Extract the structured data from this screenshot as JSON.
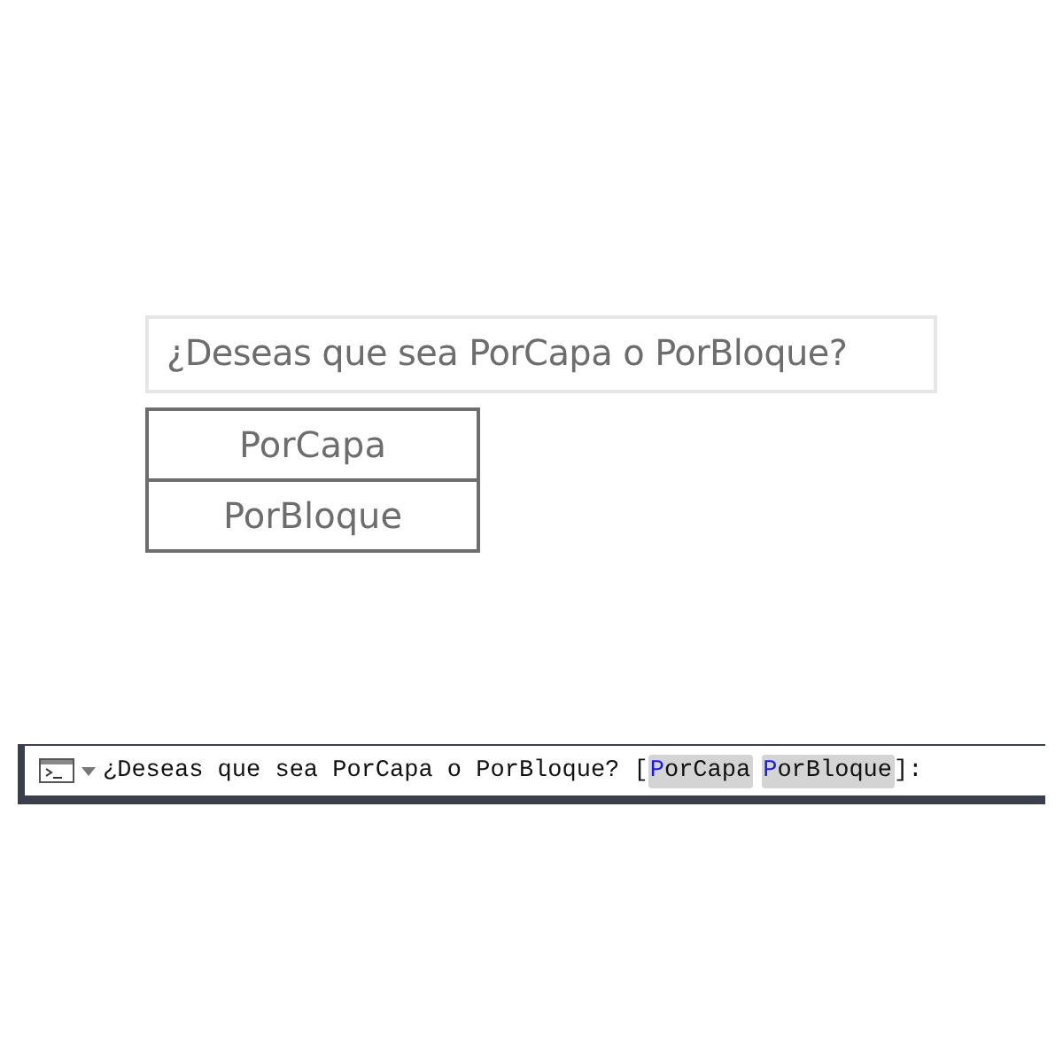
{
  "dynamic_prompt": {
    "text": "¿Deseas que sea PorCapa o PorBloque?"
  },
  "options_menu": [
    {
      "label": "PorCapa"
    },
    {
      "label": "PorBloque"
    }
  ],
  "command_line": {
    "prompt": "¿Deseas que sea PorCapa o PorBloque?",
    "open": "[",
    "close": "]:",
    "options": [
      {
        "label": "PorCapa"
      },
      {
        "label": "PorBloque"
      }
    ]
  }
}
